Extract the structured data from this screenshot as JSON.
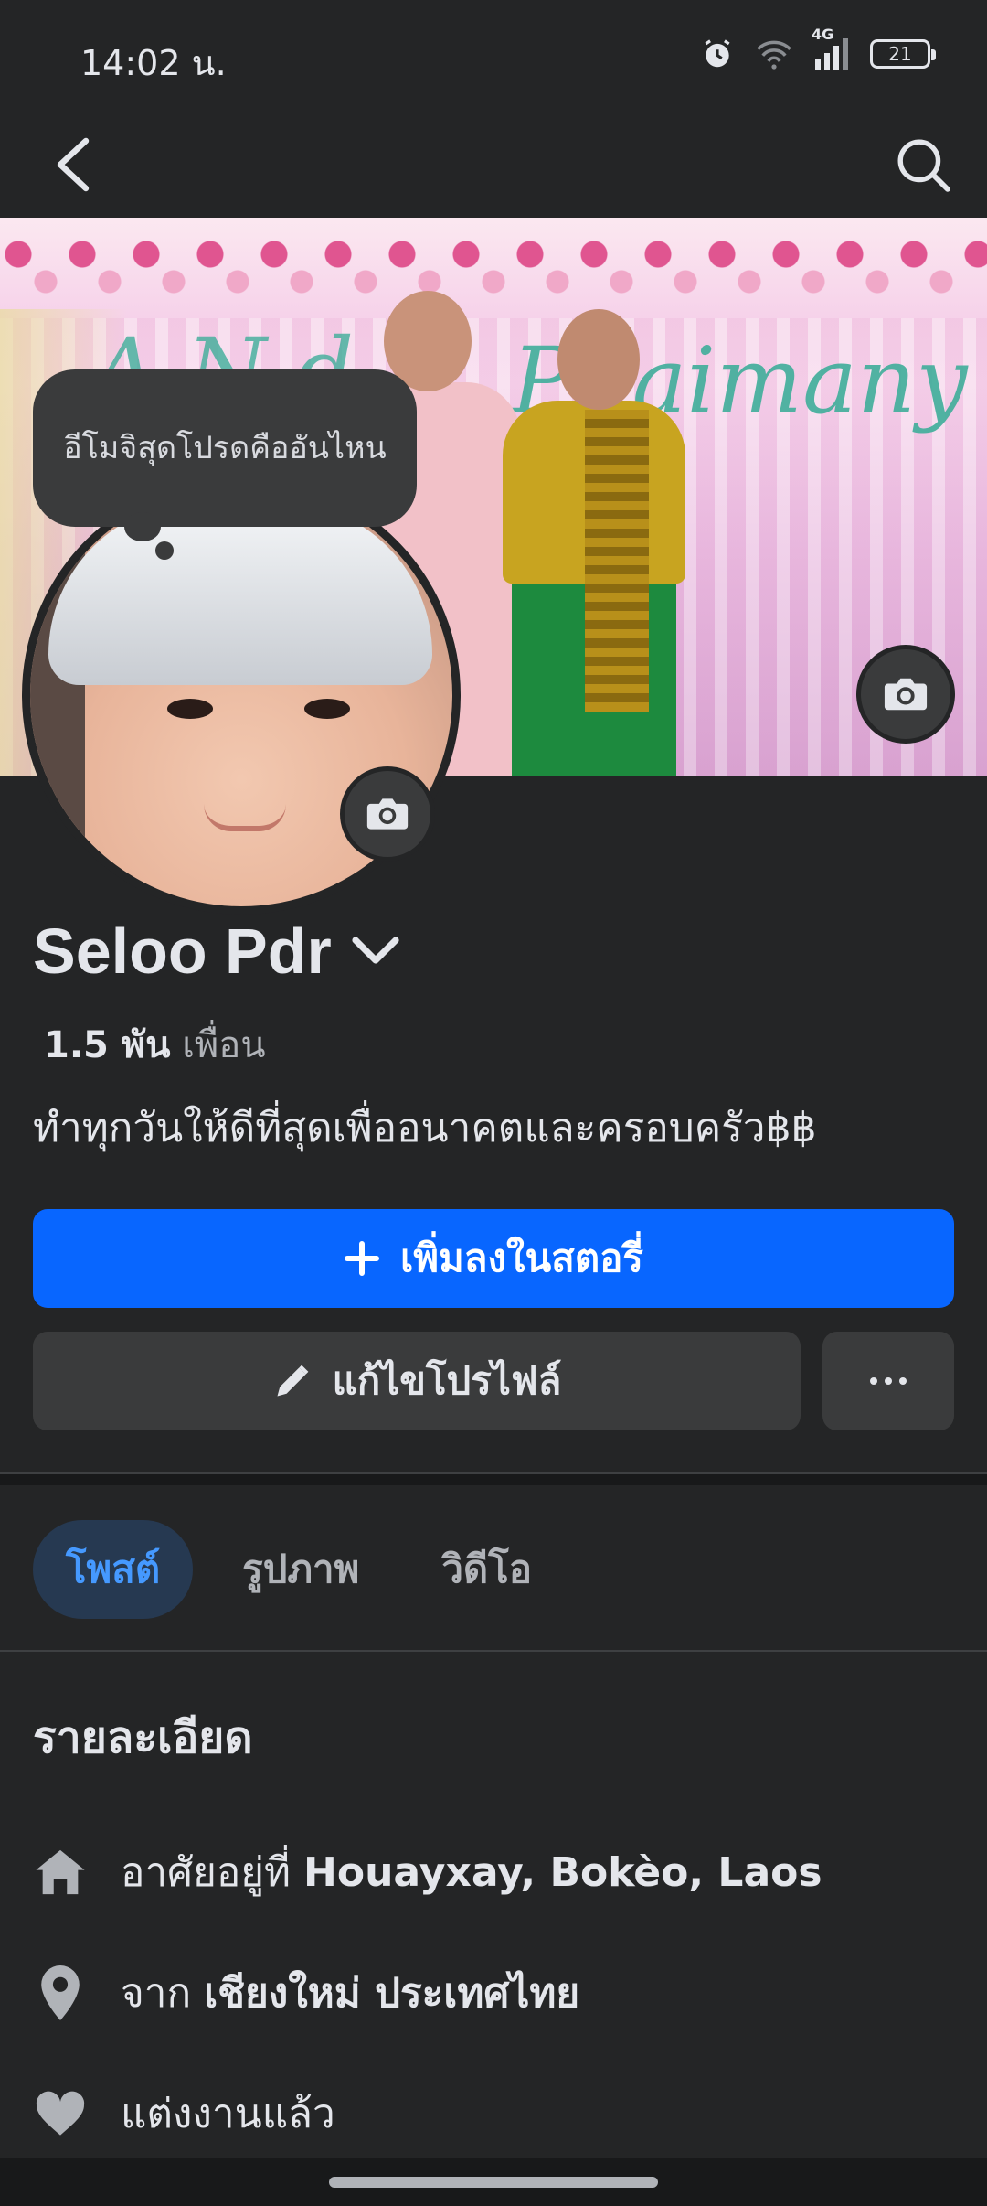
{
  "status_bar": {
    "time": "14:02 น.",
    "network": "4G",
    "battery": "21"
  },
  "nav": {
    "back_icon": "back-arrow-icon",
    "search_icon": "search-icon"
  },
  "cover": {
    "lettering_right": "Phaimany",
    "lettering_left": "A N d A"
  },
  "bubble": {
    "text": "อีโมจิสุดโปรดคืออันไหน"
  },
  "profile": {
    "name": "Seloo Pdr",
    "friends_count": "1.5 พัน",
    "friends_label": "เพื่อน",
    "bio": "ทำทุกวันให้ดีที่สุดเพื่ออนาคตและครอบครัว฿฿"
  },
  "buttons": {
    "add_story": "เพิ่มลงในสตอรี่",
    "edit_profile": "แก้ไขโปรไฟล์",
    "more": "···"
  },
  "tabs": [
    {
      "label": "โพสต์",
      "active": true
    },
    {
      "label": "รูปภาพ",
      "active": false
    },
    {
      "label": "วิดีโอ",
      "active": false
    }
  ],
  "details": {
    "title": "รายละเอียด",
    "items": [
      {
        "icon": "home-icon",
        "prefix": "อาศัยอยู่ที่ ",
        "value": "Houayxay, Bokèo, Laos"
      },
      {
        "icon": "location-pin-icon",
        "prefix": "จาก ",
        "value": "เชียงใหม่ ประเทศไทย"
      },
      {
        "icon": "heart-icon",
        "prefix": "แต่งงานแล้ว",
        "value": ""
      }
    ]
  },
  "colors": {
    "background": "#242526",
    "primary_blue": "#0866ff",
    "button_gray": "#3a3b3c",
    "active_tab_bg": "#263951",
    "active_tab_text": "#4599ff"
  }
}
